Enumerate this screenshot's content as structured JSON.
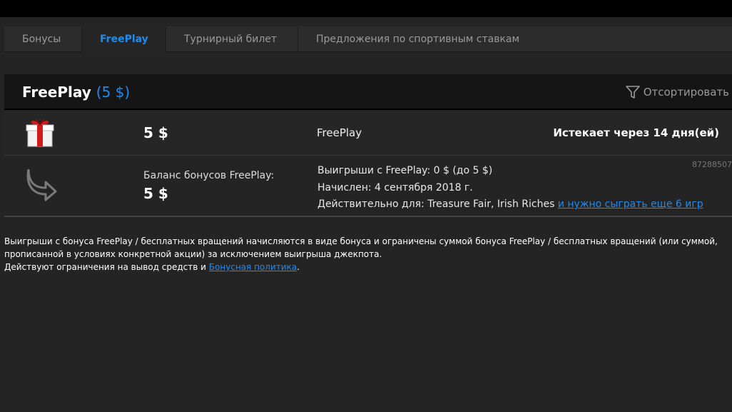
{
  "tabs": [
    "Бонусы",
    "FreePlay",
    "Турнирный билет",
    "Предложения по спортивным ставкам"
  ],
  "header": {
    "title": "FreePlay",
    "amount": "(5 $)",
    "sort_label": "Отсортировать"
  },
  "bonus": {
    "amount": "5 $",
    "type": "FreePlay",
    "expires": "Истекает через 14 дня(ей)",
    "balance_label": "Баланс бонусов FreePlay:",
    "balance_value": "5 $",
    "winnings": "Выигрыши с FreePlay: 0 $ (до 5 $)",
    "accrued": "Начислен: 4 сентября 2018 г.",
    "valid_for": "Действительно для: Treasure Fair, Irish Riches",
    "wager_link": "и нужно сыграть еще 6 игр",
    "id": "87288507"
  },
  "disclaimer": {
    "line1": "Выигрыши с бонуса FreePlay / бесплатных вращений начисляются в виде бонуса и ограничены суммой бонуса FreePlay / бесплатных вращений (или суммой, прописанной в условиях конкретной акции) за исключением выигрыша джекпота.",
    "line2_prefix": "Действуют ограничения на вывод средств и ",
    "policy_link": "Бонусная политика",
    "line2_suffix": "."
  },
  "colors": {
    "accent": "#1e8cf0",
    "background": "#242424",
    "header": "#151515"
  }
}
